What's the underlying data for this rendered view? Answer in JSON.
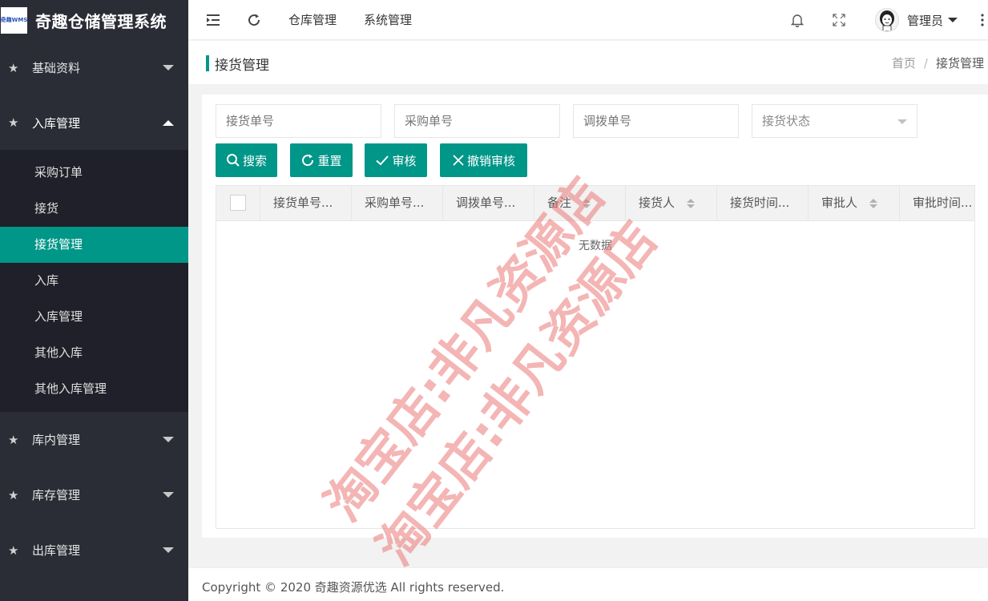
{
  "app": {
    "logo_text": "奇趣WMS",
    "title": "奇趣仓储管理系统"
  },
  "sidebar": {
    "groups": [
      {
        "label": "基础资料"
      },
      {
        "label": "入库管理"
      },
      {
        "label": "库内管理"
      },
      {
        "label": "库存管理"
      },
      {
        "label": "出库管理"
      }
    ],
    "submenu": [
      "采购订单",
      "接货",
      "接货管理",
      "入库",
      "入库管理",
      "其他入库",
      "其他入库管理"
    ]
  },
  "header": {
    "nav": [
      "仓库管理",
      "系统管理"
    ],
    "user_name": "管理员"
  },
  "page": {
    "title": "接货管理",
    "breadcrumb": {
      "home": "首页",
      "separator": "/",
      "current": "接货管理"
    }
  },
  "filters": {
    "receipt_no_placeholder": "接货单号",
    "purchase_no_placeholder": "采购单号",
    "transfer_no_placeholder": "调拨单号",
    "status_placeholder": "接货状态"
  },
  "buttons": {
    "search": "搜索",
    "reset": "重置",
    "approve": "审核",
    "cancel_approve": "撤销审核"
  },
  "table": {
    "columns": [
      "接货单号...",
      "采购单号...",
      "调拨单号...",
      "备注",
      "接货人",
      "接货时间...",
      "审批人",
      "审批时间..."
    ],
    "empty_text": "无数据"
  },
  "watermark": {
    "text": "淘宝店:非凡资源店"
  },
  "footer": {
    "copyright": "Copyright © 2020 奇趣资源优选 All rights reserved."
  },
  "colors": {
    "accent": "#009688",
    "sidebar_bg": "#2a2c36",
    "submenu_bg": "#1f2029"
  }
}
